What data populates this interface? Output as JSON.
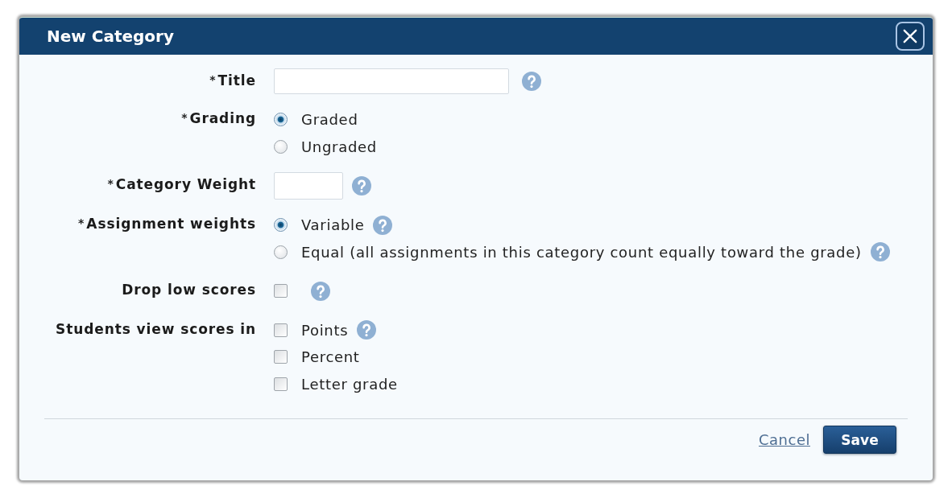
{
  "dialog": {
    "title": "New Category"
  },
  "fields": [
    {
      "kind": "text",
      "required_mark": "*",
      "label": "Title",
      "help": true
    },
    {
      "kind": "radio",
      "required_mark": "*",
      "label": "Grading",
      "options": [
        {
          "label": "Graded",
          "selected": true
        },
        {
          "label": "Ungraded",
          "selected": false
        }
      ]
    },
    {
      "kind": "number",
      "required_mark": "*",
      "label": "Category Weight",
      "help": true
    },
    {
      "kind": "radio",
      "required_mark": "*",
      "label": "Assignment weights",
      "options": [
        {
          "label": "Variable",
          "selected": true,
          "help": true
        },
        {
          "label": "Equal (all assignments in this category count equally toward the grade)",
          "selected": false,
          "help": true
        }
      ]
    },
    {
      "kind": "checkbox",
      "label": "Drop low scores",
      "checked": false,
      "help": true
    },
    {
      "kind": "checkbox-group",
      "label": "Students view scores in",
      "options": [
        {
          "label": "Points",
          "checked": false,
          "help": true
        },
        {
          "label": "Percent",
          "checked": false
        },
        {
          "label": "Letter grade",
          "checked": false
        }
      ]
    }
  ],
  "actions": [
    {
      "kind": "link",
      "label": "Cancel"
    },
    {
      "kind": "primary",
      "label": "Save"
    }
  ]
}
